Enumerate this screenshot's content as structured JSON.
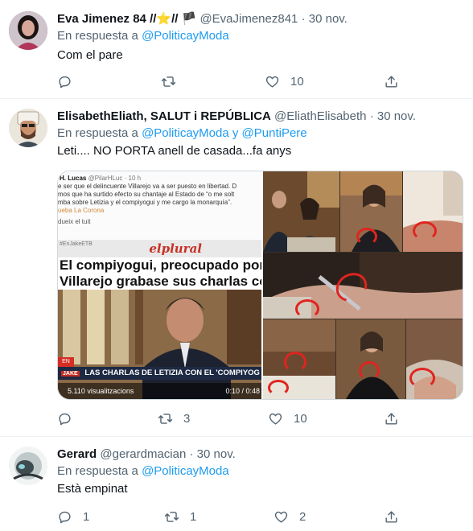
{
  "tweets": [
    {
      "name": "Eva Jimenez 84 //⭐// 🏴",
      "handle": "@EvaJimenez841",
      "time": "30 nov.",
      "reply_prefix": "En respuesta a",
      "reply_to": "@PoliticayModa",
      "reply_to_2": "",
      "reply_join": "",
      "text": "Com el pare",
      "counts": {
        "reply": "",
        "retweet": "",
        "like": "10"
      }
    },
    {
      "name": "ElisabethEliath, SALUT i REPÚBLICA",
      "handle": "@EliathElisabeth",
      "time": "30 nov.",
      "reply_prefix": "En respuesta a",
      "reply_to": "@PoliticayModa",
      "reply_join": "y",
      "reply_to_2": "@PuntiPere",
      "text": "Leti.... NO PORTA anell de casada...fa anys",
      "counts": {
        "reply": "",
        "retweet": "3",
        "like": "10"
      }
    },
    {
      "name": "Gerard",
      "handle": "@gerardmacian",
      "time": "30 nov.",
      "reply_prefix": "En respuesta a",
      "reply_to": "@PoliticayModa",
      "reply_to_2": "",
      "reply_join": "",
      "text": "Està empinat",
      "counts": {
        "reply": "1",
        "retweet": "1",
        "like": "2"
      }
    }
  ],
  "media": {
    "quoted_author": "H. Lucas",
    "quoted_handle": "@PilarHLuc",
    "quoted_time": "· 10 h",
    "quoted_lines": [
      "e ser que el delincuente Villarejo va a ser puesto en libertad. D",
      "mos que ha surtido efecto su chantaje al Estado de “o me solt",
      "mba sobre Letizia y el compiyogui y me cargo la monarquía”."
    ],
    "quoted_hashtag": "ueba La Corona",
    "translate": "dueix el tuit",
    "video_tag": "#EnJakeETB",
    "brand": "elplural",
    "headline_1": "El compiyogui, preocupado porque",
    "headline_2": "Villarejo grabase sus charlas con Let",
    "live_tag": "EN",
    "lower_third": "LAS CHARLAS DE LETIZIA CON EL 'COMPIYOG",
    "lower_tag": "JAKE",
    "views": "5.110 visualitzacions",
    "duration": "0:10 / 0:48"
  },
  "colors": {
    "link": "#1d9bf0",
    "muted": "#536471",
    "text": "#0f1419",
    "divider": "#eff3f4",
    "brand_red": "#c63025"
  },
  "icons": {
    "reply": "reply-icon",
    "retweet": "retweet-icon",
    "like": "heart-icon",
    "share": "share-icon"
  }
}
